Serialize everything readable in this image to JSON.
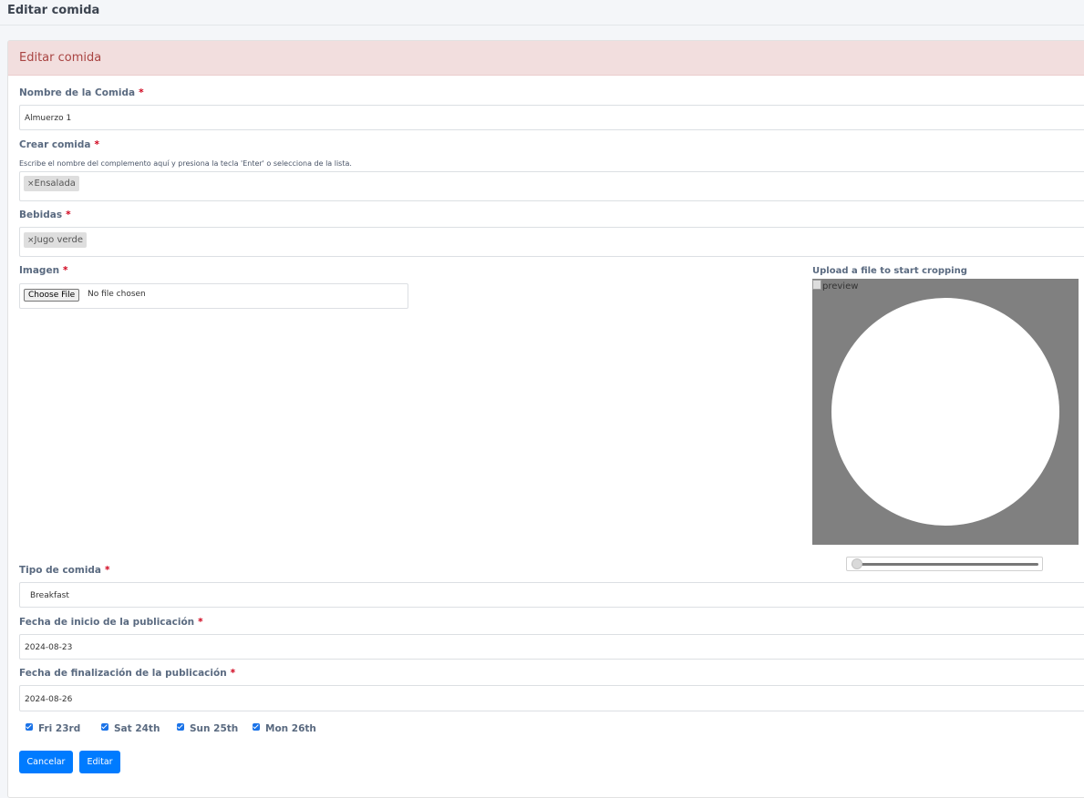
{
  "page": {
    "title": "Editar comida"
  },
  "card": {
    "header": "Editar comida"
  },
  "form": {
    "nombre": {
      "label": "Nombre de la Comida",
      "required": "*",
      "value": "Almuerzo 1"
    },
    "crear": {
      "label": "Crear comida",
      "required": "*",
      "hint": "Escribe el nombre del complemento aquí y presiona la tecla 'Enter' o selecciona de la lista.",
      "tags": [
        {
          "x": "×",
          "label": "Ensalada"
        }
      ]
    },
    "bebidas": {
      "label": "Bebidas",
      "required": "*",
      "tags": [
        {
          "x": "×",
          "label": "Jugo verde"
        }
      ]
    },
    "imagen": {
      "label": "Imagen",
      "required": "*",
      "button": "Choose File",
      "status": "No file chosen"
    },
    "cropper": {
      "title": "Upload a file to start cropping",
      "preview_alt": "preview",
      "zoom": 0
    },
    "tipo": {
      "label": "Tipo de comida",
      "required": "*",
      "value": "Breakfast"
    },
    "inicio": {
      "label": "Fecha de inicio de la publicación",
      "required": "*",
      "value": "2024-08-23"
    },
    "fin": {
      "label": "Fecha de finalización de la publicación",
      "required": "*",
      "value": "2024-08-26"
    },
    "days": [
      {
        "label": "Fri 23rd",
        "checked": true
      },
      {
        "label": "Sat 24th",
        "checked": true
      },
      {
        "label": "Sun 25th",
        "checked": true
      },
      {
        "label": "Mon 26th",
        "checked": true
      }
    ],
    "buttons": {
      "cancel": "Cancelar",
      "submit": "Editar"
    }
  },
  "colors": {
    "accent": "#007bff",
    "header_bg": "#f2dede",
    "header_text": "#a94442",
    "required": "#d0021b"
  }
}
